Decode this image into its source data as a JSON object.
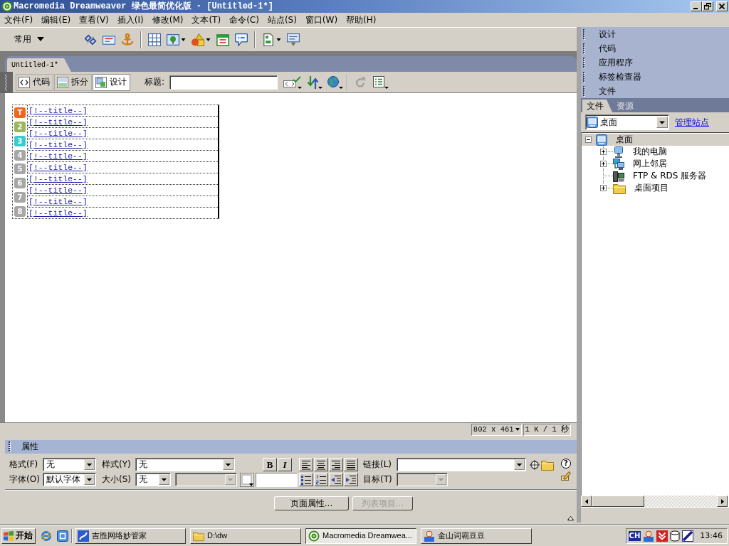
{
  "window": {
    "title": "Macromedia Dreamweaver 绿色最简优化版 - [Untitled-1*]"
  },
  "menu": [
    "文件(F)",
    "编辑(E)",
    "查看(V)",
    "插入(I)",
    "修改(M)",
    "文本(T)",
    "命令(C)",
    "站点(S)",
    "窗口(W)",
    "帮助(H)"
  ],
  "insert_bar": {
    "category": "常用"
  },
  "document": {
    "tab": "Untitled-1*",
    "views": [
      {
        "label": "代码",
        "selected": false
      },
      {
        "label": "拆分",
        "selected": false
      },
      {
        "label": "设计",
        "selected": true
      }
    ],
    "title_label": "标题:",
    "badges": [
      {
        "label": "T",
        "color": "#f0661a"
      },
      {
        "label": "2",
        "color": "#9ab85a"
      },
      {
        "label": "3",
        "color": "#38cccc"
      },
      {
        "label": "4",
        "color": "#a6a6a6"
      },
      {
        "label": "5",
        "color": "#a6a6a6"
      },
      {
        "label": "6",
        "color": "#a6a6a6"
      },
      {
        "label": "7",
        "color": "#a6a6a6"
      },
      {
        "label": "8",
        "color": "#a6a6a6"
      }
    ],
    "links": [
      "[!--title--]",
      "[!--title--]",
      "[!--title--]",
      "[!--title--]",
      "[!--title--]",
      "[!--title--]",
      "[!--title--]",
      "[!--title--]",
      "[!--title--]",
      "[!--title--]"
    ],
    "status": {
      "size": "802 x 461",
      "speed": "1 K / 1 秒"
    }
  },
  "properties": {
    "title": "属性",
    "format": {
      "label": "格式(F)",
      "value": "无"
    },
    "style": {
      "label": "样式(Y)",
      "value": "无"
    },
    "bold": "B",
    "italic": "I",
    "link": {
      "label": "链接(L)",
      "disabled": false
    },
    "font": {
      "label": "字体(O)",
      "value": "默认字体"
    },
    "size": {
      "label": "大小(S)",
      "value": "无"
    },
    "size_unit": {
      "disabled": true
    },
    "target": {
      "label": "目标(T)",
      "disabled": true
    },
    "help": "?",
    "buttons": [
      {
        "label": "页面属性...",
        "disabled": false
      },
      {
        "label": "列表项目...",
        "disabled": true
      }
    ]
  },
  "panels": {
    "groups": [
      "设计",
      "代码",
      "应用程序",
      "标签检查器",
      "文件"
    ],
    "tabs": [
      {
        "label": "文件",
        "selected": true
      },
      {
        "label": "资源",
        "selected": false
      }
    ],
    "site": "桌面",
    "manage_link": "管理站点",
    "tree": [
      {
        "label": "桌面",
        "kind": "desktop",
        "expandable": true,
        "expanded": true,
        "selected": true,
        "children": [
          {
            "label": "我的电脑",
            "kind": "computer",
            "expandable": true,
            "expanded": false,
            "selected": false
          },
          {
            "label": "网上邻居",
            "kind": "network",
            "expandable": true,
            "expanded": false,
            "selected": false
          },
          {
            "label": "FTP & RDS 服务器",
            "kind": "server",
            "expandable": false,
            "selected": false
          },
          {
            "label": "桌面项目",
            "kind": "folder",
            "expandable": true,
            "expanded": false,
            "selected": false
          }
        ]
      }
    ]
  },
  "taskbar": {
    "start": "开始",
    "tasks": [
      {
        "label": "吉胜网络妙管家",
        "kind": "app",
        "selected": false
      },
      {
        "label": "D:\\dw",
        "kind": "folder",
        "selected": false
      },
      {
        "label": "Macromedia Dreamwea...",
        "kind": "dreamweaver",
        "selected": true
      },
      {
        "label": "金山词霸豆豆",
        "kind": "dictionary",
        "selected": false
      }
    ],
    "language": "CH",
    "clock": "13:46"
  }
}
